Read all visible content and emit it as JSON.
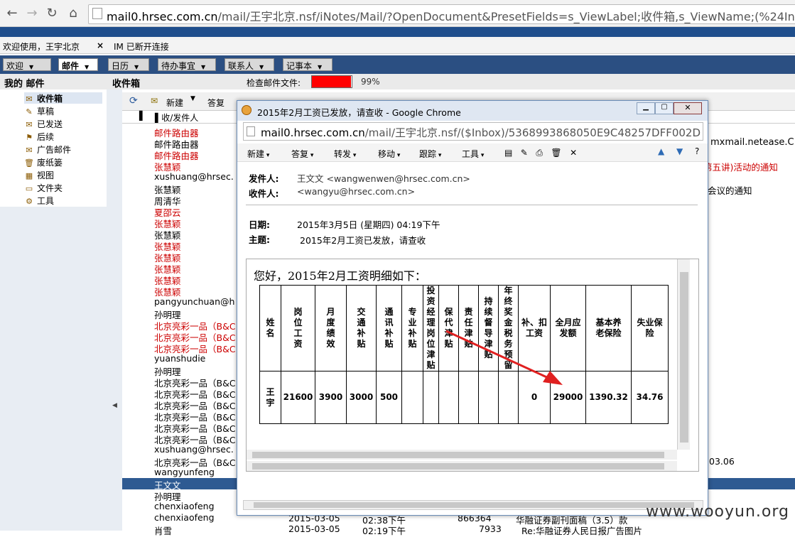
{
  "browser": {
    "url_host": "mail0.hrsec.com.cn",
    "url_path": "/mail/王宇北京.nsf/iNotes/Mail/?OpenDocument&PresetFields=s_ViewLabel;收件箱,s_ViewName;(%24Inbox)"
  },
  "welcome": {
    "greeting": "欢迎使用，王宇北京",
    "close": "×",
    "im_status": "IM 已断开连接"
  },
  "tabs": [
    "欢迎",
    "邮件",
    "日历",
    "待办事宜",
    "联系人",
    "记事本"
  ],
  "header": {
    "my_mail": "我的 邮件",
    "inbox": "收件箱",
    "check_label": "检查邮件文件:",
    "progress_text": "99%",
    "progress": 0.99
  },
  "folders": [
    "收件箱",
    "草稿",
    "已发送",
    "后续",
    "广告邮件",
    "废纸篓",
    "视图",
    "文件夹",
    "工具"
  ],
  "list_toolbar": {
    "new": "新建",
    "reply": "答复"
  },
  "list_header": {
    "from": "收/发件人"
  },
  "senders": [
    {
      "name": "邮件路由器",
      "red": true
    },
    {
      "name": "邮件路由器",
      "red": false
    },
    {
      "name": "邮件路由器",
      "red": true
    },
    {
      "name": "张慧颖",
      "red": true
    },
    {
      "name": "xushuang@hrsec.",
      "red": false
    },
    {
      "name": "张慧颖",
      "red": false
    },
    {
      "name": "周清华",
      "red": false
    },
    {
      "name": "夏邵云",
      "red": true
    },
    {
      "name": "张慧颖",
      "red": true
    },
    {
      "name": "张慧颖",
      "red": false
    },
    {
      "name": "张慧颖",
      "red": true
    },
    {
      "name": "张慧颖",
      "red": true
    },
    {
      "name": "张慧颖",
      "red": true
    },
    {
      "name": "张慧颖",
      "red": true
    },
    {
      "name": "张慧颖",
      "red": true
    },
    {
      "name": "pangyunchuan@h",
      "red": false
    },
    {
      "name": "孙明理",
      "red": false
    },
    {
      "name": "北京亮彩一品（B&C",
      "red": true
    },
    {
      "name": "北京亮彩一品（B&C",
      "red": true
    },
    {
      "name": "北京亮彩一品（B&C",
      "red": true
    },
    {
      "name": "yuanshudie",
      "red": false
    },
    {
      "name": "孙明理",
      "red": false
    },
    {
      "name": "北京亮彩一品（B&C",
      "red": false
    },
    {
      "name": "北京亮彩一品（B&C",
      "red": false
    },
    {
      "name": "北京亮彩一品（B&C",
      "red": false
    },
    {
      "name": "北京亮彩一品（B&C",
      "red": false
    },
    {
      "name": "北京亮彩一品（B&C",
      "red": false
    },
    {
      "name": "北京亮彩一品（B&C",
      "red": false
    },
    {
      "name": "xushuang@hrsec.",
      "red": false
    },
    {
      "name": "北京亮彩一品（B&C",
      "red": false
    },
    {
      "name": "wangyunfeng",
      "red": false
    },
    {
      "name": "王文文",
      "red": false
    },
    {
      "name": "孙明理",
      "red": false
    },
    {
      "name": "chenxiaofeng",
      "red": false
    },
    {
      "name": "chenxiaofeng",
      "red": false
    },
    {
      "name": "肖雪",
      "red": false
    }
  ],
  "right_snippets": {
    "s1": "mxmail.netease.C",
    "s2": "第五讲)活动的通知",
    "s3": "会议的通知",
    "s4": "03.06",
    "bottom1_date": "2015-03-05",
    "bottom1_time": "02:38下午",
    "bottom1_size": "866364",
    "bottom1_subj": "华融证券副刊面稿（3.5）款",
    "bottom2_date": "2015-03-05",
    "bottom2_time": "02:19下午",
    "bottom2_size": "7933",
    "bottom2_subj": "Re:华融证券人民日报广告图片"
  },
  "popup": {
    "title": "2015年2月工资已发放，请查收 - Google Chrome",
    "url_host": "mail0.hrsec.com.cn",
    "url_path": "/mail/王宇北京.nsf/($Inbox)/5368993868050E9C48257DFF002D",
    "toolbar": [
      "新建",
      "答复",
      "转发",
      "移动",
      "跟踪",
      "工具"
    ],
    "from_label": "发件人:",
    "from": "王文文 <wangwenwen@hrsec.com.cn>",
    "to_label": "收件人:",
    "to": "<wangyu@hrsec.com.cn>",
    "date_label": "日期:",
    "date": "2015年3月5日 (星期四) 04:19下午",
    "subject_label": "主题:",
    "subject": "2015年2月工资已发放，请查收",
    "greeting": "您好，2015年2月工资明细如下："
  },
  "salary_table": {
    "headers": [
      "姓名",
      "岗位工资",
      "月度绩效",
      "交通补贴",
      "通讯补贴",
      "专业补贴",
      "投资经理岗位津贴",
      "保代津贴",
      "责任津贴",
      "持续督导津贴",
      "年终奖金税务预留",
      "补、扣工资",
      "全月应发额",
      "基本养老保险",
      "失业保险"
    ],
    "values": [
      "王宇",
      "21600",
      "3900",
      "3000",
      "500",
      "",
      "",
      "",
      "",
      "",
      "",
      "0",
      "29000",
      "1390.32",
      "34.76"
    ]
  },
  "watermark": "www.wooyun.org"
}
